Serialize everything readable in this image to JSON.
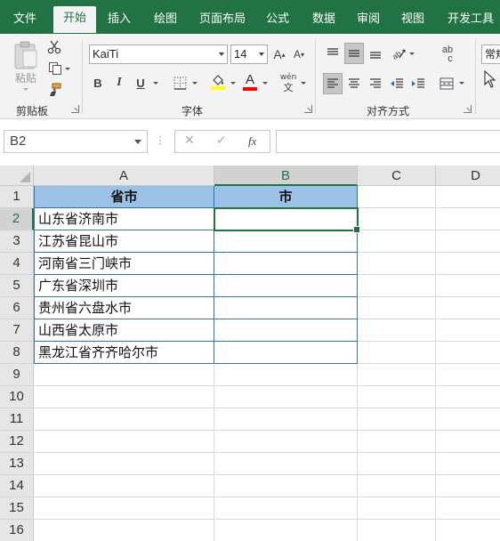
{
  "tabs": [
    "文件",
    "开始",
    "插入",
    "绘图",
    "页面布局",
    "公式",
    "数据",
    "审阅",
    "视图",
    "开发工具"
  ],
  "active_tab": "开始",
  "ribbon": {
    "paste_label": "粘贴",
    "clipboard_label": "剪贴板",
    "font_group_label": "字体",
    "align_group_label": "对齐方式",
    "font_name": "KaiTi",
    "font_size": "14",
    "bold": "B",
    "italic": "I",
    "underline": "U",
    "grow_font": "A",
    "shrink_font": "A",
    "font_color_glyph": "A",
    "phonetic_top": "wén",
    "phonetic_bottom": "文",
    "number_format": "常规",
    "wrap_glyph": "ab",
    "wrap_glyph2": "c"
  },
  "formula_bar": {
    "name_box": "B2",
    "cancel": "✕",
    "confirm": "✓",
    "fx": "fx",
    "formula": ""
  },
  "colors": {
    "accent": "#217346",
    "header_fill": "#9bc2e6",
    "table_border": "#2f75b5"
  },
  "sheet": {
    "columns": [
      "A",
      "B",
      "C",
      "D"
    ],
    "rows": [
      "1",
      "2",
      "3",
      "4",
      "5",
      "6",
      "7",
      "8",
      "9",
      "10",
      "11",
      "12",
      "13",
      "14",
      "15",
      "16"
    ],
    "headers": {
      "A": "省市",
      "B": "市"
    },
    "data": [
      "山东省济南市",
      "江苏省昆山市",
      "河南省三门峡市",
      "广东省深圳市",
      "贵州省六盘水市",
      "山西省太原市",
      "黑龙江省齐齐哈尔市"
    ]
  }
}
